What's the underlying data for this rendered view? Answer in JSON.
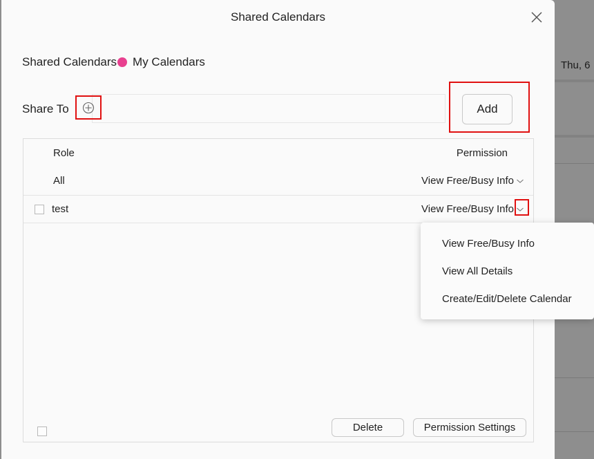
{
  "background": {
    "day_label": "Thu, 6"
  },
  "dialog": {
    "title": "Shared Calendars",
    "close_icon": "close-icon",
    "tabs": {
      "shared": "Shared Calendars",
      "mine": "My Calendars",
      "dot_color": "#e8408f"
    },
    "share_to": {
      "label": "Share To",
      "add_contact_icon": "plus-circle-icon",
      "input_value": "",
      "input_placeholder": ""
    },
    "add_button": "Add",
    "table": {
      "columns": [
        "Role",
        "Permission"
      ],
      "rows": [
        {
          "role": "All",
          "permission": "View Free/Busy Info",
          "has_checkbox": false,
          "checked": false
        },
        {
          "role": "test",
          "permission": "View Free/Busy Info",
          "has_checkbox": true,
          "checked": false
        }
      ]
    },
    "footer": {
      "select_all_checked": false,
      "delete_button": "Delete",
      "permission_settings_button": "Permission Settings"
    },
    "permission_dropdown": {
      "open": true,
      "options": [
        "View Free/Busy Info",
        "View All Details",
        "Create/Edit/Delete Calendar"
      ]
    },
    "highlight_color": "#e01010"
  }
}
